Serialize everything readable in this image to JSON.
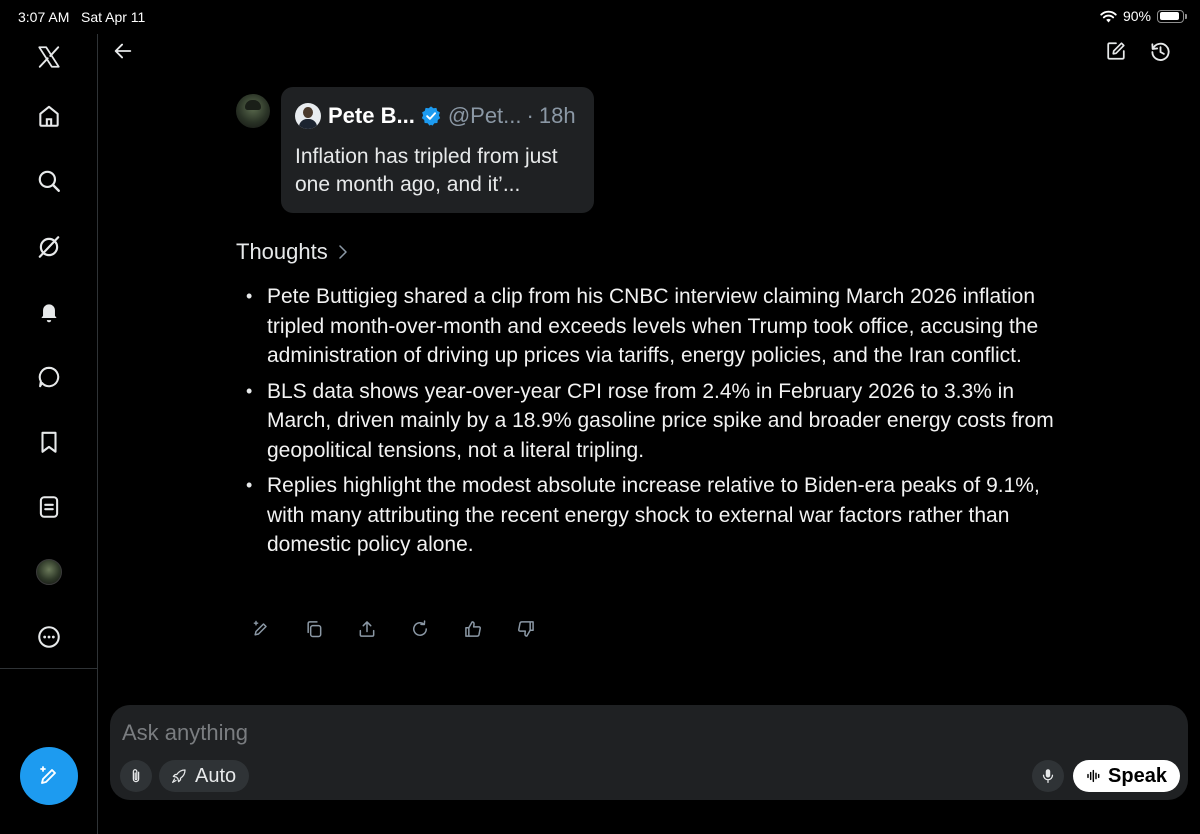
{
  "status_bar": {
    "time": "3:07 AM",
    "date": "Sat Apr 11",
    "battery": "90%",
    "battery_level": 0.9
  },
  "sidebar": {
    "items": [
      {
        "icon": "x-logo-icon"
      },
      {
        "icon": "home-icon"
      },
      {
        "icon": "search-icon"
      },
      {
        "icon": "grok-icon"
      },
      {
        "icon": "bell-icon"
      },
      {
        "icon": "messages-icon"
      },
      {
        "icon": "bookmark-icon"
      },
      {
        "icon": "lists-icon"
      },
      {
        "icon": "profile-avatar"
      },
      {
        "icon": "more-icon"
      }
    ],
    "fab_icon": "compose-icon"
  },
  "quote": {
    "name": "Pete B...",
    "handle": "@Pet...",
    "dot": "·",
    "time": "18h",
    "text": "Inflation has tripled from just one month ago, and it’..."
  },
  "thoughts": {
    "label": "Thoughts",
    "bullets": [
      "Pete Buttigieg shared a clip from his CNBC interview claiming March 2026 inflation tripled month-over-month and exceeds levels when Trump took office, accusing the administration of driving up prices via tariffs, energy policies, and the Iran conflict.",
      "BLS data shows year-over-year CPI rose from 2.4% in February 2026 to 3.3% in March, driven mainly by a 18.9% gasoline price spike and broader energy costs from geopolitical tensions, not a literal tripling.",
      "Replies highlight the modest absolute increase relative to Biden-era peaks of 9.1%, with many attributing the recent energy shock to external war factors rather than domestic policy alone."
    ]
  },
  "composer": {
    "placeholder": "Ask anything",
    "mode_label": "Auto",
    "speak_label": "Speak"
  },
  "colors": {
    "accent": "#1d9bf0",
    "background": "#000000",
    "card": "#1f2123"
  }
}
